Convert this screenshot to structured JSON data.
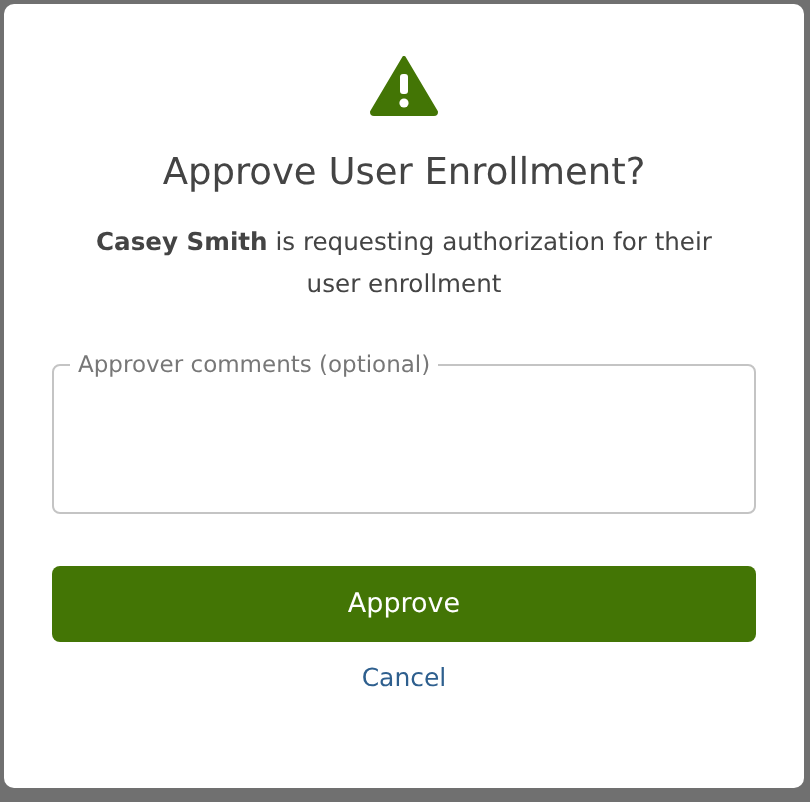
{
  "dialog": {
    "title": "Approve User Enrollment?",
    "message": "**Casey Smith** is requesting authorization for their user enrollment",
    "comments": {
      "label": "Approver comments (optional)"
    },
    "buttons": [
      {
        "label": "Approve",
        "kind": "primary"
      },
      {
        "label": "Cancel",
        "kind": "link"
      }
    ]
  }
}
